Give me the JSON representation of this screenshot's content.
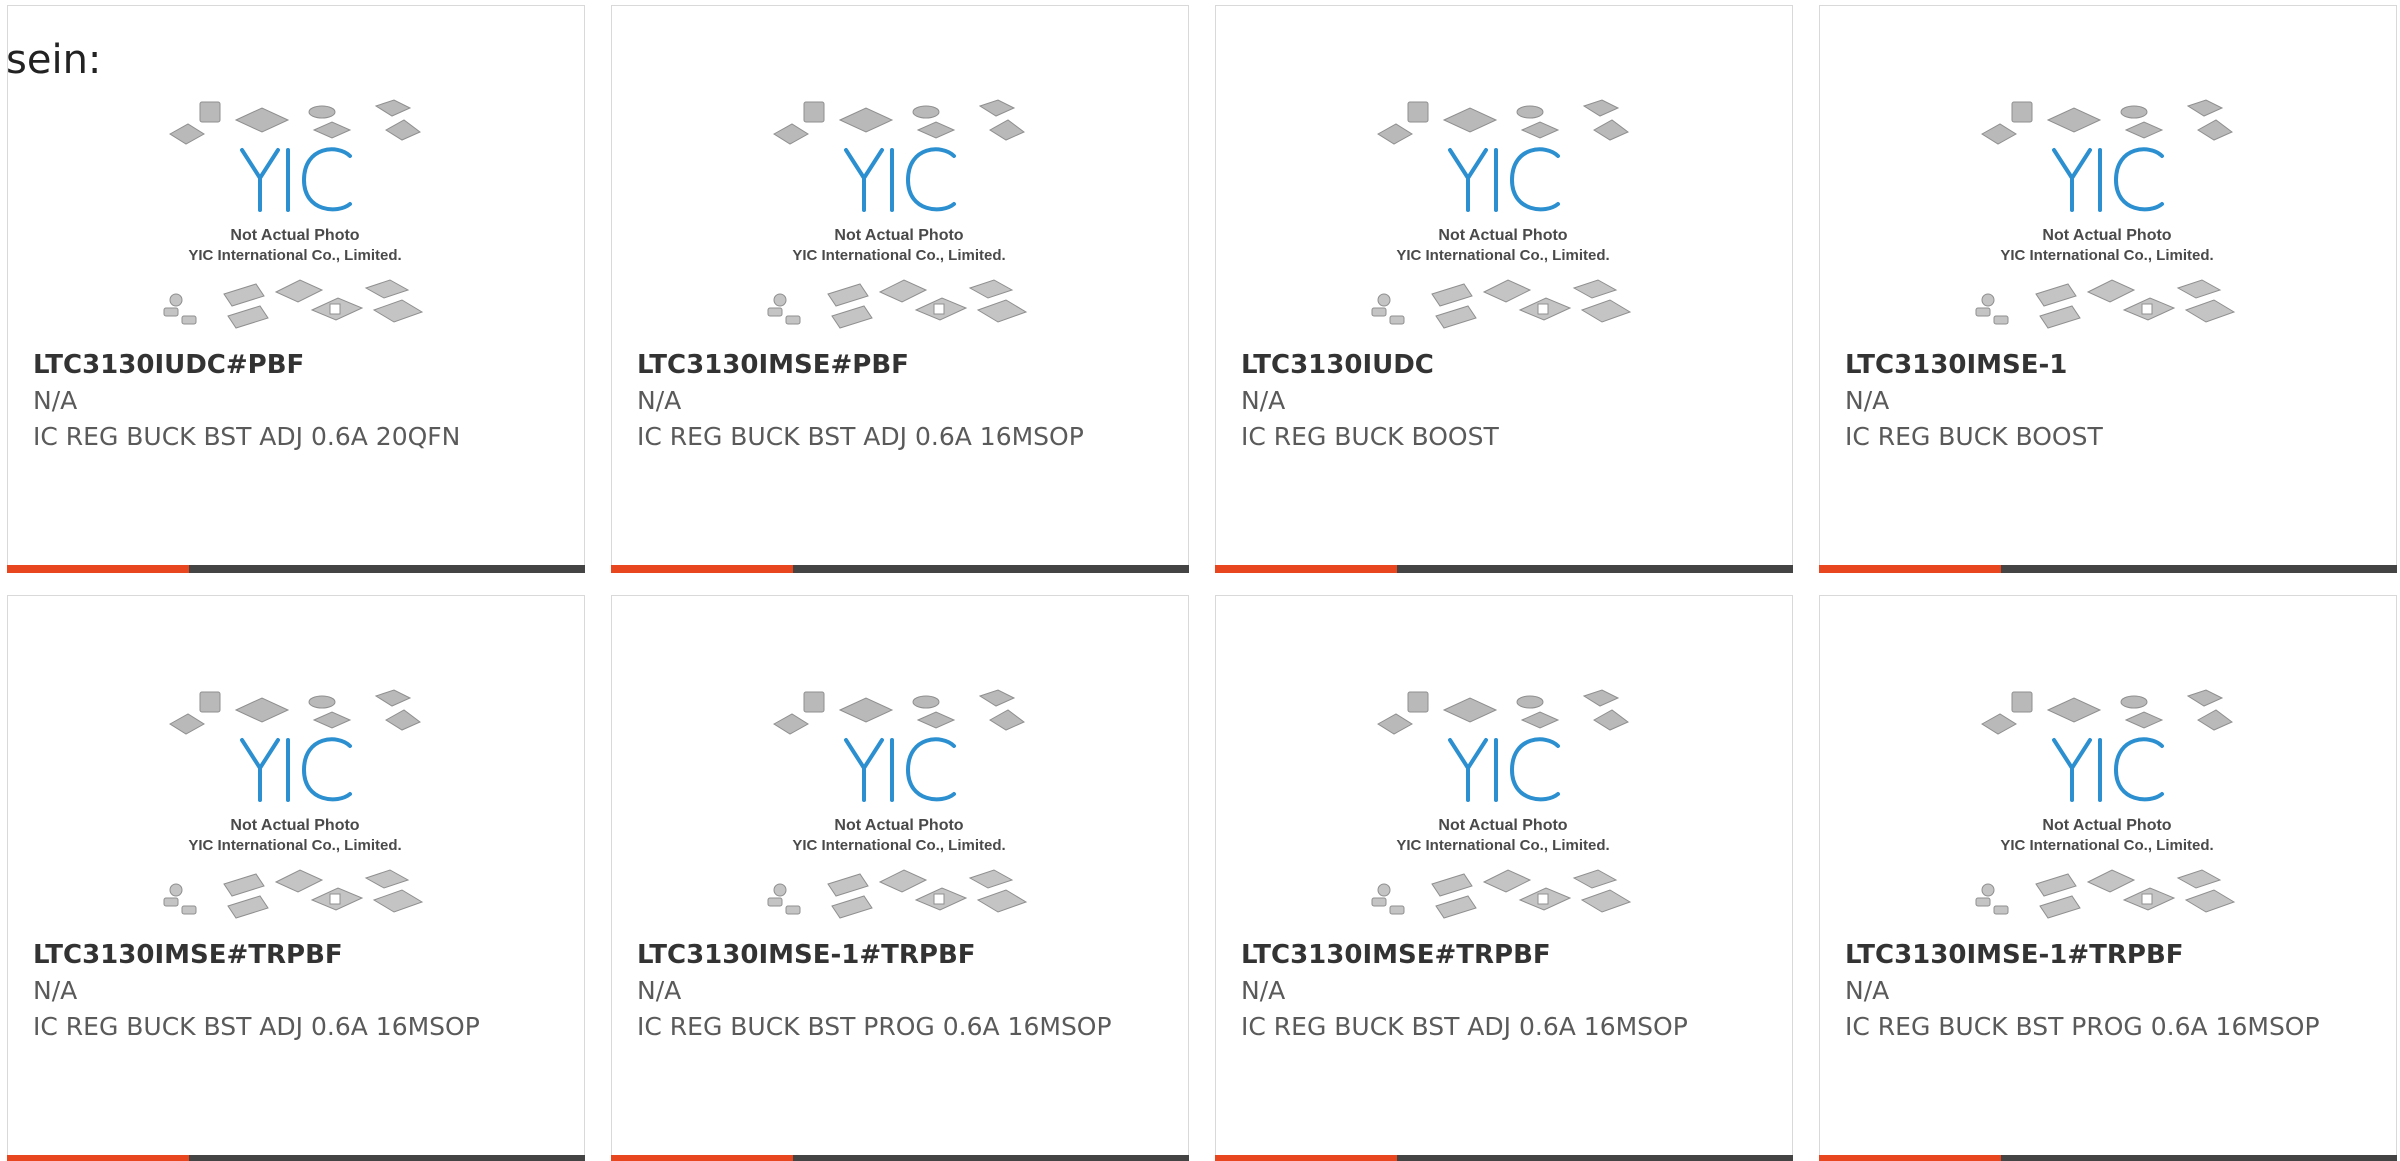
{
  "intro_text": "sein:",
  "colors": {
    "accent_bar": "#e8461f",
    "dark_bar": "#444444",
    "logo_blue": "#2b8fd0"
  },
  "placeholder": {
    "logo_text": "YIC",
    "line1": "Not Actual Photo",
    "line2": "YIC International Co., Limited."
  },
  "products": [
    {
      "name": "LTC3130IUDC#PBF",
      "mfr": "N/A",
      "desc": "IC REG BUCK BST ADJ 0.6A 20QFN"
    },
    {
      "name": "LTC3130IMSE#PBF",
      "mfr": "N/A",
      "desc": "IC REG BUCK BST ADJ 0.6A 16MSOP"
    },
    {
      "name": "LTC3130IUDC",
      "mfr": "N/A",
      "desc": "IC REG BUCK BOOST"
    },
    {
      "name": "LTC3130IMSE-1",
      "mfr": "N/A",
      "desc": "IC REG BUCK BOOST"
    },
    {
      "name": "LTC3130IMSE#TRPBF",
      "mfr": "N/A",
      "desc": "IC REG BUCK BST ADJ 0.6A 16MSOP"
    },
    {
      "name": "LTC3130IMSE-1#TRPBF",
      "mfr": "N/A",
      "desc": "IC REG BUCK BST PROG 0.6A 16MSOP"
    },
    {
      "name": "LTC3130IMSE#TRPBF",
      "mfr": "N/A",
      "desc": "IC REG BUCK BST ADJ 0.6A 16MSOP"
    },
    {
      "name": "LTC3130IMSE-1#TRPBF",
      "mfr": "N/A",
      "desc": "IC REG BUCK BST PROG 0.6A 16MSOP"
    }
  ]
}
